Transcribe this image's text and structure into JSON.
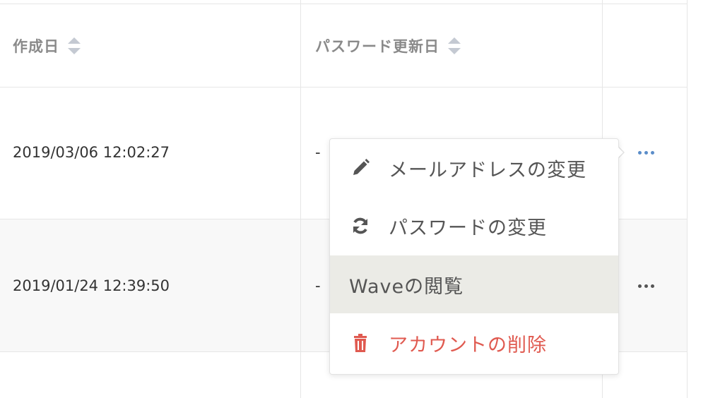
{
  "columns": {
    "created": "作成日",
    "password_updated": "パスワード更新日"
  },
  "rows": [
    {
      "created": "2019/03/06 12:02:27",
      "password_updated": "-"
    },
    {
      "created": "2019/01/24 12:39:50",
      "password_updated": "-"
    }
  ],
  "menu": {
    "items": [
      {
        "label": "メールアドレスの変更",
        "icon": "pencil-icon"
      },
      {
        "label": "パスワードの変更",
        "icon": "refresh-icon"
      },
      {
        "label": "Waveの閲覧",
        "icon": ""
      },
      {
        "label": "アカウントの削除",
        "icon": "trash-icon"
      }
    ]
  },
  "colors": {
    "active_dots": "#5b8dc9",
    "inactive_dots": "#555555",
    "danger": "#e05a50",
    "hover_bg": "#ebebe6"
  }
}
